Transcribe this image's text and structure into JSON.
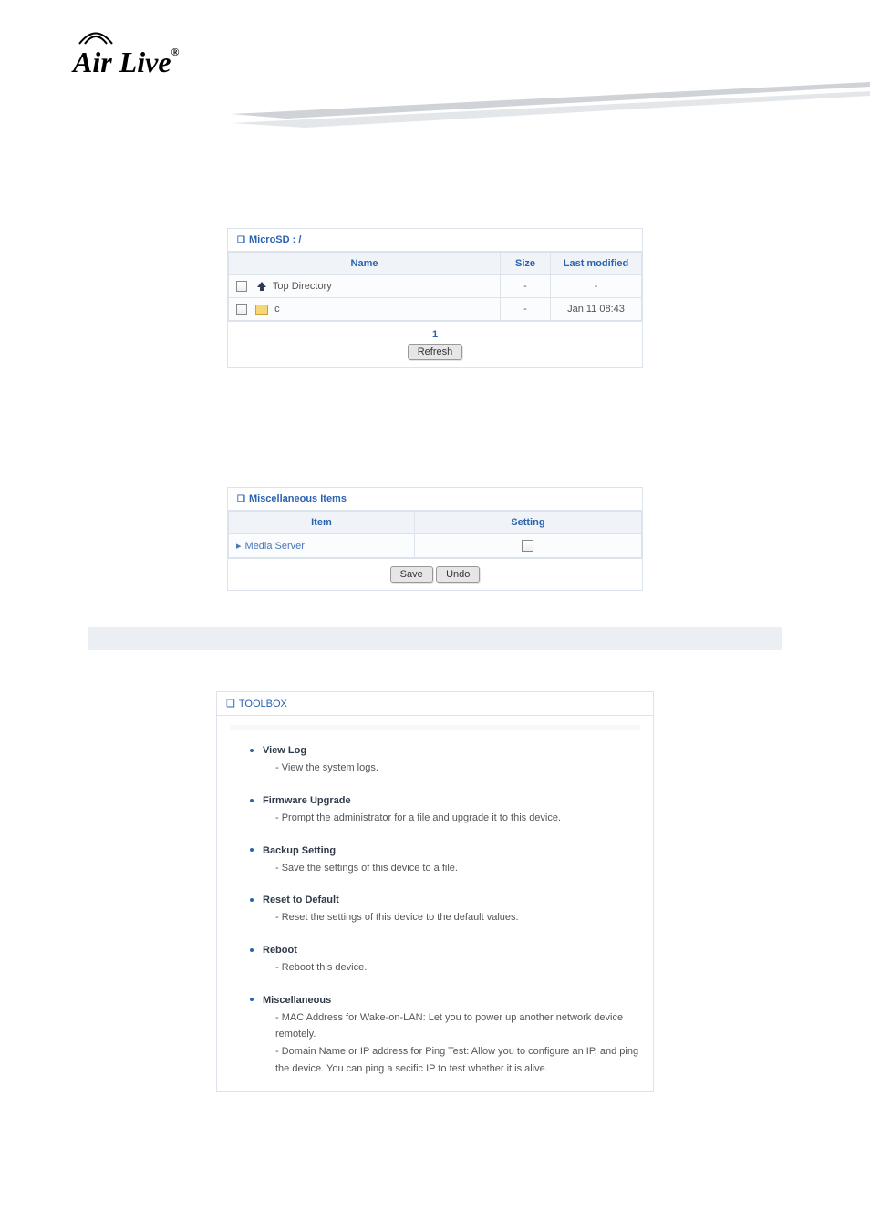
{
  "logo": {
    "text": "Air Live",
    "reg": "®"
  },
  "microsd": {
    "title": "MicroSD : /",
    "headers": {
      "name": "Name",
      "size": "Size",
      "modified": "Last modified"
    },
    "rows": [
      {
        "name": "Top Directory",
        "size": "-",
        "modified": "-",
        "type": "top"
      },
      {
        "name": "c",
        "size": "-",
        "modified": "Jan 11 08:43",
        "type": "folder"
      }
    ],
    "page": "1",
    "refresh_label": "Refresh"
  },
  "misc": {
    "title": "Miscellaneous Items",
    "headers": {
      "item": "Item",
      "setting": "Setting"
    },
    "row": {
      "item": "Media Server"
    },
    "save_label": "Save",
    "undo_label": "Undo"
  },
  "toolbox": {
    "title": "TOOLBOX",
    "items": [
      {
        "name": "View Log",
        "desc": "- View the system logs."
      },
      {
        "name": "Firmware Upgrade",
        "desc": "- Prompt the administrator for a file and upgrade it to this device."
      },
      {
        "name": "Backup Setting",
        "desc": "- Save the settings of this device to a file."
      },
      {
        "name": "Reset to Default",
        "desc": "- Reset the settings of this device to the default values."
      },
      {
        "name": "Reboot",
        "desc": "- Reboot this device."
      },
      {
        "name": "Miscellaneous",
        "desc": "- MAC Address for Wake-on-LAN: Let you to power up another network device remotely.\n- Domain Name or IP address for Ping Test: Allow you to configure an IP, and ping the device. You can ping a secific IP to test whether it is alive."
      }
    ]
  }
}
